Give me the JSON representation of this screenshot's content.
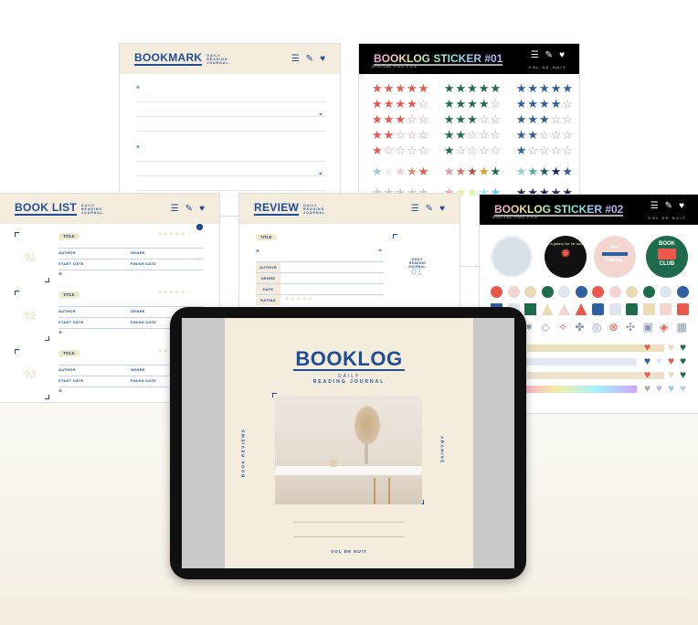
{
  "colors": {
    "brand_blue": "#1f4e96",
    "cream": "#f4ecdc",
    "red": "#e9584a",
    "green": "#1e6b4c",
    "blue": "#2f5fa0"
  },
  "header_icons": [
    "menu-icon",
    "pencil-icon",
    "heart-icon"
  ],
  "bookmark": {
    "title": "BOOKMARK",
    "subtitle": "DAILY READING JOURNAL."
  },
  "sticker1": {
    "title": "BOOKLOG STICKER #01",
    "subtitle": "DIGITAL PNG FILE",
    "brand": "VOL DE NUIT",
    "ratings": [
      5,
      4,
      3,
      2,
      1
    ]
  },
  "booklist": {
    "title": "BOOK LIST",
    "subtitle": "DAILY READING JOURNAL.",
    "entries": [
      {
        "num": "01",
        "title": "TITLE",
        "author": "AUTHOR",
        "genre": "GENRE",
        "start": "START DATE",
        "finish": "FINISH DATE"
      },
      {
        "num": "02",
        "title": "TITLE",
        "author": "AUTHOR",
        "genre": "GENRE",
        "start": "START DATE",
        "finish": "FINISH DATE"
      },
      {
        "num": "03",
        "title": "TITLE",
        "author": "AUTHOR",
        "genre": "GENRE",
        "start": "START DATE",
        "finish": "FINISH DATE"
      }
    ]
  },
  "review": {
    "title": "REVIEW",
    "subtitle": "DAILY READING JOURNAL.",
    "pill": "TITLE",
    "fields": [
      "AUTHOR",
      "GENRE",
      "DATE",
      "RATING"
    ],
    "side_label": "DAILY READING JOURNAL.",
    "side_num": "01"
  },
  "sticker2": {
    "title": "BOOKLOG STICKER #02",
    "subtitle": "DIGITAL PNG FILE",
    "brand": "VOL DE NUIT",
    "badge_galaxy": "In a galaxy far, far away",
    "badge_reading_top": "Now",
    "badge_reading_bottom": "Reading...",
    "badge_club_top": "BOOK",
    "badge_club_bottom": "CLUB"
  },
  "cover": {
    "title": "BOOKLOG",
    "line1": "DAILY",
    "line2": "READING JOURNAL",
    "left_tab": "BOOK REVIEWS",
    "right_tab": "ARCHIVE",
    "footer": "VOL DE NUIT"
  }
}
